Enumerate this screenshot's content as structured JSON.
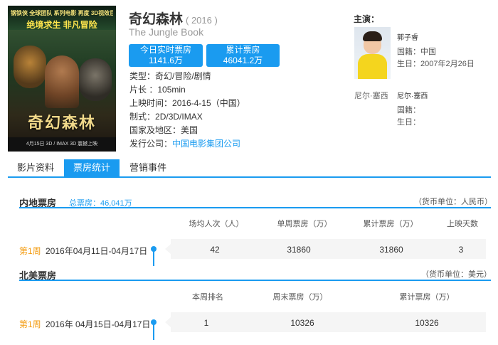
{
  "poster": {
    "top_line": "钢铁侠 全球团队 系列电影 再度 3D视效巨献",
    "tagline": "绝境求生 非凡冒险",
    "title": "奇幻森林",
    "footer": "4月15日 3D / IMAX 3D 震撼上映"
  },
  "movie": {
    "title": "奇幻森林",
    "year": "( 2016 )",
    "english_title": "The Jungle Book"
  },
  "stats": {
    "today_label": "今日实时票房",
    "today_value": "1141.6万",
    "total_label": "累计票房",
    "total_value": "46041.2万"
  },
  "info": {
    "genre_label": "类型：",
    "genre": "奇幻/冒险/剧情",
    "length_label": "片长 ：",
    "length": "105min",
    "release_label": "上映时间：",
    "release": "2016-4-15（中国）",
    "format_label": "制式：",
    "format": "2D/3D/IMAX",
    "region_label": "国家及地区：",
    "region": "美国",
    "distributor_label": "发行公司：",
    "distributor": "中国电影集团公司"
  },
  "cast": {
    "header": "主演：",
    "actor1_name": "郭子睿",
    "actor1_nationality": "国籍：中国",
    "actor1_birth": "生日：2007年2月26日",
    "actor2_alt": "尼尔·塞西",
    "actor2_name": "尼尔·塞西",
    "actor2_nationality": "国籍：",
    "actor2_birth": "生日："
  },
  "tabs": {
    "info": "影片资料",
    "boxoffice": "票房统计",
    "marketing": "营销事件"
  },
  "mainland": {
    "title": "内地票房",
    "total": "总票房：46,041万",
    "unit": "（货币单位：人民币）",
    "headers": [
      "场均人次（人）",
      "单周票房（万）",
      "累计票房（万）",
      "上映天数"
    ],
    "week": "第1周",
    "dates": "2016年04月11日-04月17日",
    "values": [
      "42",
      "31860",
      "31860",
      "3"
    ]
  },
  "northamerica": {
    "title": "北美票房",
    "unit": "（货币单位：美元）",
    "headers": [
      "本周排名",
      "周末票房（万）",
      "累计票房（万）"
    ],
    "week": "第1周",
    "dates": "2016年 04月15日-04月17日",
    "values": [
      "1",
      "10326",
      "10326"
    ]
  },
  "colors": {
    "accent": "#1a9bf0",
    "week_label": "#f39c12"
  },
  "icons": {
    "timeline_dot": "timeline-dot-icon"
  }
}
